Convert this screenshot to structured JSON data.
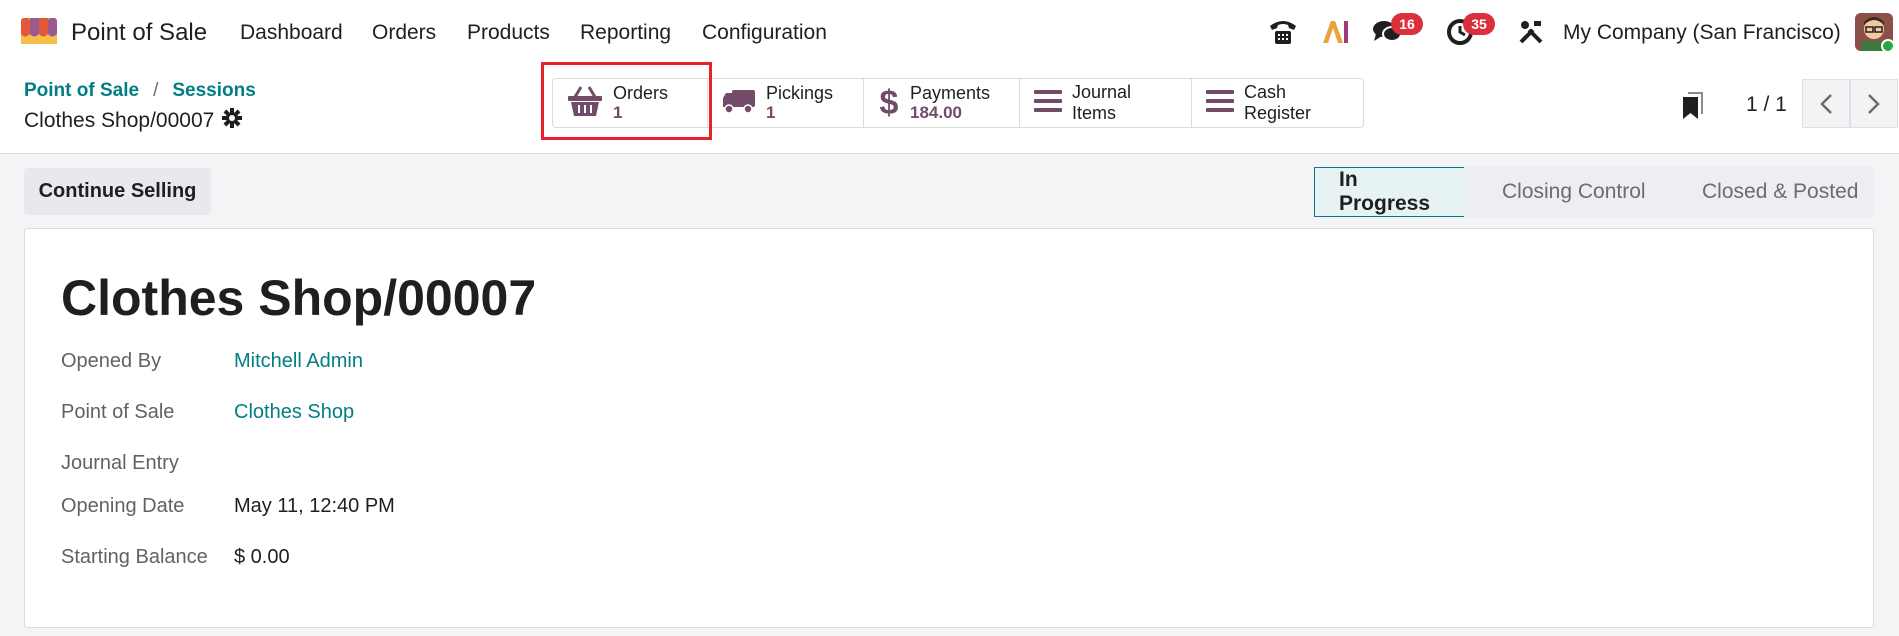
{
  "app": {
    "name": "Point of Sale",
    "menu": [
      "Dashboard",
      "Orders",
      "Products",
      "Reporting",
      "Configuration"
    ],
    "icons": [
      "phone-icon",
      "ai-icon",
      "chat-icon",
      "activity-clock-icon",
      "tools-icon"
    ],
    "chat_badge": "16",
    "activity_badge": "35",
    "company": "My Company (San Francisco)"
  },
  "breadcrumb": {
    "items": [
      "Point of Sale",
      "Sessions"
    ],
    "separator": "/",
    "current": "Clothes Shop/00007"
  },
  "smart_buttons": [
    {
      "label": "Orders",
      "value": "1",
      "icon": "basket-icon"
    },
    {
      "label": "Pickings",
      "value": "1",
      "icon": "truck-icon"
    },
    {
      "label": "Payments",
      "value": "184.00",
      "icon": "dollar-icon"
    },
    {
      "label": "Journal Items",
      "icon": "list-icon"
    },
    {
      "label": "Cash Register",
      "icon": "list-icon"
    }
  ],
  "pager": {
    "text": "1 / 1"
  },
  "actions": {
    "continue_selling": "Continue Selling"
  },
  "status": {
    "stages": [
      "In Progress",
      "Closing Control",
      "Closed & Posted"
    ],
    "active": "In Progress"
  },
  "record": {
    "title": "Clothes Shop/00007",
    "fields": [
      {
        "label": "Opened By",
        "value": "Mitchell Admin"
      },
      {
        "label": "Point of Sale",
        "value": "Clothes Shop"
      },
      {
        "label": "Journal Entry",
        "value": ""
      },
      {
        "label": "Opening Date",
        "value": "May 11, 12:40 PM"
      },
      {
        "label": "Starting Balance",
        "value": "$ 0.00"
      }
    ]
  },
  "colors": {
    "accent": "#017e84",
    "brand": "#714b67",
    "badge": "#d9303c",
    "highlight": "#e8222a"
  }
}
